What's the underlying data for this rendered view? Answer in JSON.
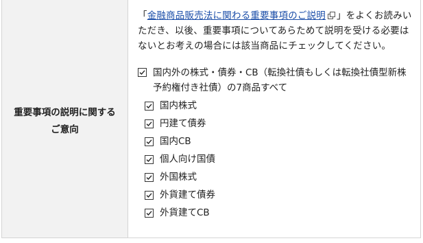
{
  "row": {
    "label_line1": "重要事項の説明に関する",
    "label_line2": "ご意向"
  },
  "intro": {
    "quote_open": "「",
    "link_text": "金融商品販売法に関わる重要事項のご説明",
    "link_icon": "external-window-icon",
    "text_after": "」をよくお読みいただき、以後、重要事項についてあらためて説明を受ける必要はないとお考えの場合には該当商品にチェックしてください。"
  },
  "options": {
    "all": {
      "label": "国内外の株式・債券・CB（転換社債もしくは転換社債型新株予約権付き社債）の7商品すべて",
      "checked": true
    },
    "items": [
      {
        "label": "国内株式",
        "checked": true
      },
      {
        "label": "円建て債券",
        "checked": true
      },
      {
        "label": "国内CB",
        "checked": true
      },
      {
        "label": "個人向け国債",
        "checked": true
      },
      {
        "label": "外国株式",
        "checked": true
      },
      {
        "label": "外貨建て債券",
        "checked": true
      },
      {
        "label": "外貨建てCB",
        "checked": true
      }
    ]
  },
  "colors": {
    "label_bg": "#f2f2f2",
    "border": "#d4d4d4",
    "link": "#1a4da8",
    "text": "#222222"
  }
}
